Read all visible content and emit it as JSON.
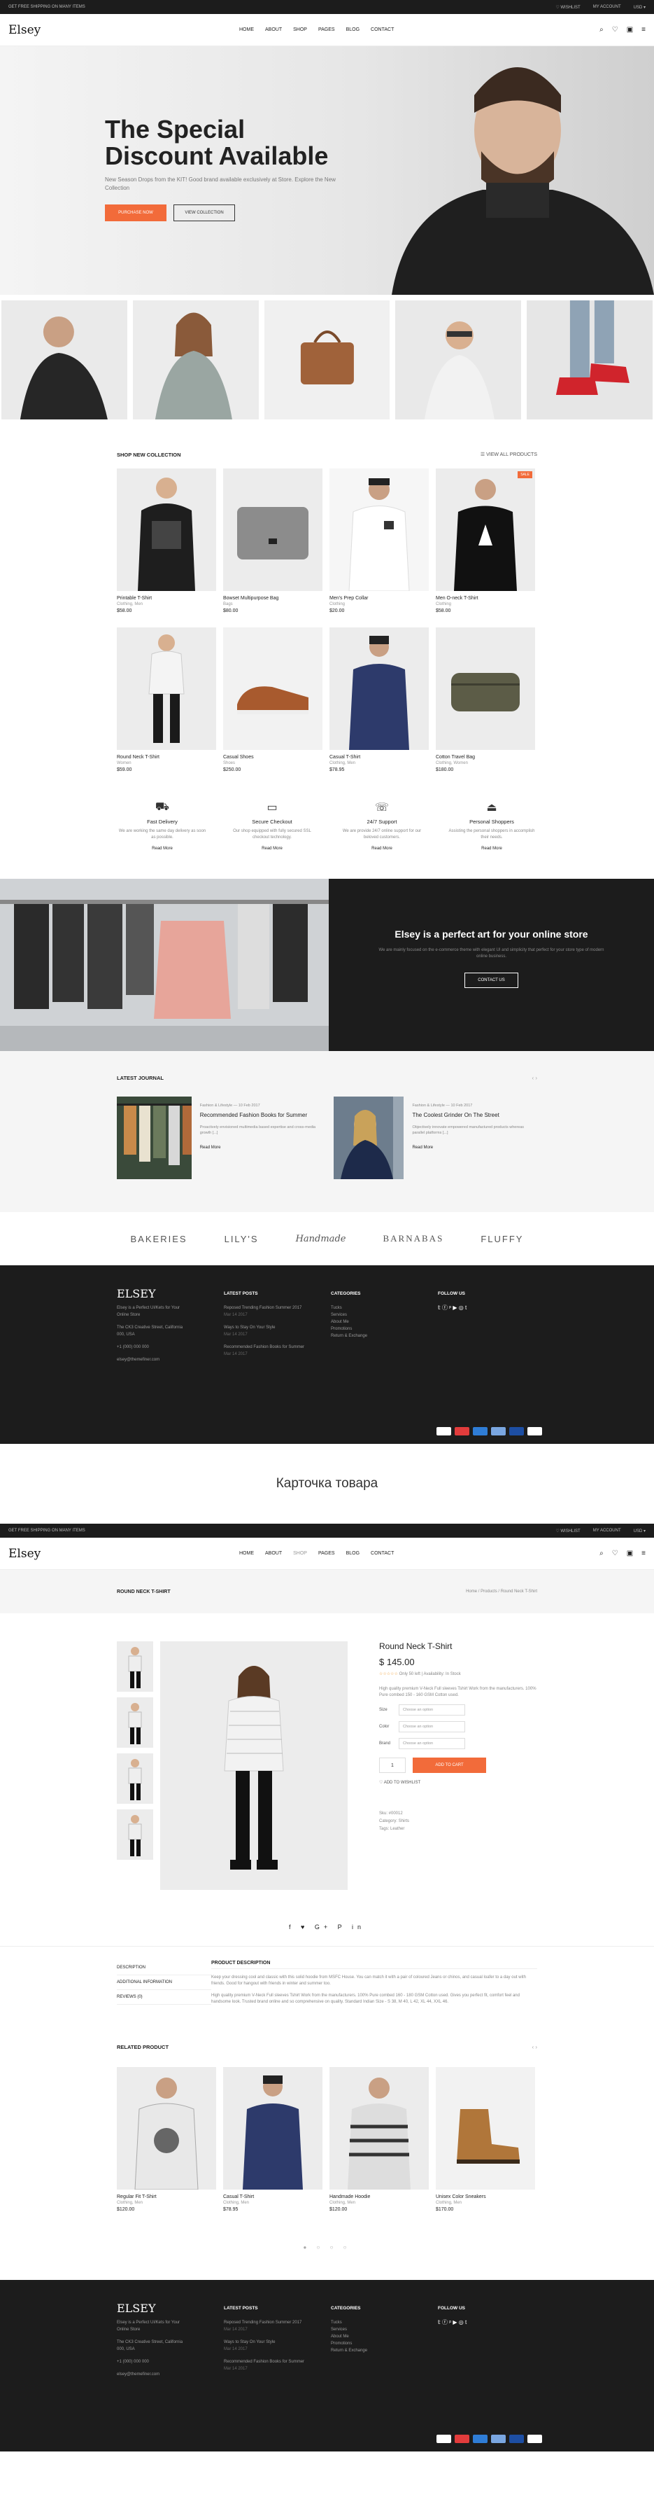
{
  "topbar": {
    "left": "GET FREE SHIPPING ON MANY ITEMS",
    "r1": "♡ WISHLIST",
    "r2": "MY ACCOUNT",
    "r3": "USD ▾"
  },
  "logo": "Elsey",
  "nav": [
    "HOME",
    "ABOUT",
    "SHOP",
    "PAGES",
    "BLOG",
    "CONTACT"
  ],
  "hero": {
    "title": "The Special Discount Available",
    "text": "New Season Drops from the KIT! Good brand available exclusively at Store. Explore the New Collection",
    "btn1": "PURCHASE NOW",
    "btn2": "VIEW COLLECTION"
  },
  "shop": {
    "title": "SHOP NEW COLLECTION",
    "view_all": "☰ VIEW ALL PRODUCTS",
    "sale": "SALE",
    "products": [
      {
        "name": "Printable T-Shirt",
        "cat": "Clothing, Men",
        "price": "$58.00"
      },
      {
        "name": "Bowset Multipurpose Bag",
        "cat": "Bags",
        "price": "$80.00"
      },
      {
        "name": "Men's Prep Collar",
        "cat": "Clothing",
        "price": "$20.00"
      },
      {
        "name": "Men O-neck T-Shirt",
        "cat": "Clothing",
        "price": "$58.00"
      },
      {
        "name": "Round Neck T-Shirt",
        "cat": "Women",
        "price": "$59.00"
      },
      {
        "name": "Casual Shoes",
        "cat": "Shoes",
        "price": "$250.00"
      },
      {
        "name": "Casual T-Shirt",
        "cat": "Clothing, Men",
        "price": "$78.95"
      },
      {
        "name": "Cotton Travel Bag",
        "cat": "Clothing, Women",
        "price": "$180.00"
      }
    ]
  },
  "features": [
    {
      "title": "Fast Delivery",
      "desc": "We are working the same day delivery as soon as possible.",
      "link": "Read More"
    },
    {
      "title": "Secure Checkout",
      "desc": "Our shop equipped with fully secured SSL checkout technology.",
      "link": "Read More"
    },
    {
      "title": "24/7 Support",
      "desc": "We are provide 24/7 online support for our beloved customers.",
      "link": "Read More"
    },
    {
      "title": "Personal Shoppers",
      "desc": "Assisting the personal shoppers in accomplish their needs.",
      "link": "Read More"
    }
  ],
  "banner": {
    "title": "Elsey is a perfect art for your online store",
    "desc": "We are mainly focused on the e-commerce theme with elegant UI and simplicity that perfect for your store type of modern online business.",
    "btn": "CONTACT US"
  },
  "journal": {
    "title": "LATEST JOURNAL",
    "posts": [
      {
        "meta": "Fashion & Lifestyle  —  10 Feb 2017",
        "title": "Recommended Fashion Books for Summer",
        "desc": "Proactively envisioned multimedia based expertise and cross-media growth [...]",
        "link": "Read More"
      },
      {
        "meta": "Fashion & Lifestyle  —  10 Feb 2017",
        "title": "The Coolest Grinder On The Street",
        "desc": "Objectively innovate empowered manufactured products whereas parallel platforms [...]",
        "link": "Read More"
      }
    ]
  },
  "brands": [
    "BAKERIES",
    "LILY'S",
    "Handmade",
    "BARNABAS",
    "FLUFFY"
  ],
  "footer": {
    "logo": "ELSEY",
    "about": "Elsey is a Perfect UI/Kets for Your Online Store",
    "address": "The CK3 Creative Street, California 000, USA",
    "phone": "+1 (000) 000 000",
    "email": "elsey@themefiner.com",
    "latest_title": "LATEST POSTS",
    "latest": [
      "Reposed Trending Fashion Summer 2017",
      "Ways to Stay On Your Style",
      "Recommended Fashion Books for Summer"
    ],
    "latest_dates": [
      "Mar 14 2017",
      "Mar 14 2017",
      "Mar 14 2017"
    ],
    "cat_title": "CATEGORIES",
    "cats": [
      "Tucks",
      "Services",
      "About Me",
      "Promotions",
      "Return & Exchange"
    ],
    "follow_title": "FOLLOW US",
    "social": "𝕥 ⓕ ᵖ ▶ ◎ t"
  },
  "caption": "Карточка товара",
  "pdp": {
    "crumb_title": "ROUND NECK T-SHIRT",
    "crumb_path": "Home / Products / Round Neck T-Shirt",
    "name": "Round Neck T-Shirt",
    "price": "$ 145.00",
    "stars": "☆☆☆☆☆",
    "sku_line": "Only 50 left  |  Availability: In Stock",
    "desc": "High quality premium V-Neck Full sleeves Tshirt Work from the manufacturers. 100% Pure combed 150 - 160 GSM Cotton used.",
    "size_label": "Size",
    "color_label": "Color",
    "brand_label": "Brand",
    "choose": "Choose an option",
    "qty": "1",
    "add": "ADD TO CART",
    "wish": "♡  ADD TO WISHLIST",
    "sku": "Sku: #00012",
    "category": "Category: Shirts",
    "tags": "Tags: Leather",
    "share": "f ♥ G+ P in",
    "tabs": [
      "DESCRIPTION",
      "ADDITIONAL INFORMATION",
      "REVIEWS (0)"
    ],
    "desc_title": "PRODUCT DESCRIPTION",
    "desc_p1": "Keep your dressing cool and classic with this solid hoodie from MSFC House. You can match it with a pair of coloured Jeans or chinos, and casual loafer to a day out with friends. Good for hangout with friends in winter and summer too.",
    "desc_p2": "High quality premium V-Neck Full sleeves Tshirt Work from the manufacturers. 100% Pure combed 160 - 180 GSM Cotton used. Gives you perfect fit, comfort feel and handsome look. Trusted brand online and so comprehensive on quality. Standard Indian Size - S 38, M 40, L 42, XL 44, XXL 46."
  },
  "related": {
    "title": "RELATED PRODUCT",
    "products": [
      {
        "name": "Regular Fit T-Shirt",
        "cat": "Clothing, Men",
        "price": "$120.00"
      },
      {
        "name": "Casual T-Shirt",
        "cat": "Clothing, Men",
        "price": "$78.95"
      },
      {
        "name": "Handmade Hoodie",
        "cat": "Clothing, Men",
        "price": "$120.00"
      },
      {
        "name": "Unisex Color Sneakers",
        "cat": "Clothing, Men",
        "price": "$170.00"
      }
    ]
  },
  "dots": "● ○ ○ ○"
}
